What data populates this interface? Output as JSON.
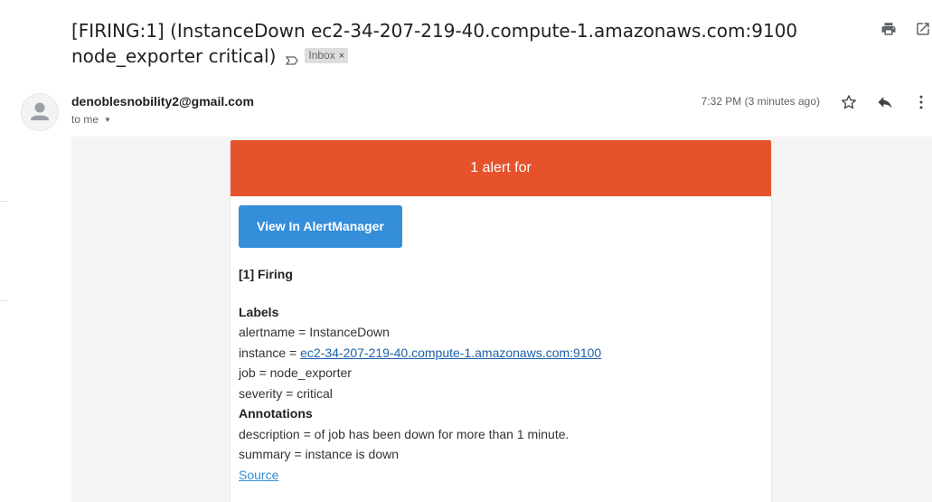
{
  "subject": {
    "text": "[FIRING:1] (InstanceDown ec2-34-207-219-40.compute-1.amazonaws.com:9100 node_exporter critical)",
    "label_badge": "Inbox",
    "label_badge_close": "×"
  },
  "toolbar_icons": [
    "print-icon",
    "open-in-new-window-icon"
  ],
  "message": {
    "sender": "denoblesnobility2@gmail.com",
    "recipient_text": "to me",
    "timestamp": "7:32 PM (3 minutes ago)",
    "action_icons": [
      "star-icon",
      "reply-icon",
      "more-vert-icon"
    ]
  },
  "alert_email": {
    "banner": "1 alert for",
    "button_label": "View In AlertManager",
    "firing_heading": "[1] Firing",
    "labels_heading": "Labels",
    "labels": [
      {
        "prefix": "alertname = ",
        "value": "InstanceDown"
      },
      {
        "prefix": "instance = ",
        "value": "ec2-34-207-219-40.compute-1.amazonaws.com:9100"
      },
      {
        "prefix": "job = ",
        "value": "node_exporter"
      },
      {
        "prefix": "severity = ",
        "value": "critical"
      }
    ],
    "annotations_heading": "Annotations",
    "annotations": [
      {
        "prefix": "description = ",
        "value": "of job has been down for more than 1 minute."
      },
      {
        "prefix": "summary = ",
        "value": "instance is down"
      }
    ],
    "source_link": "Source"
  },
  "colors": {
    "banner": "#e6522c",
    "button": "#348eda",
    "link": "#1a5fa8"
  }
}
